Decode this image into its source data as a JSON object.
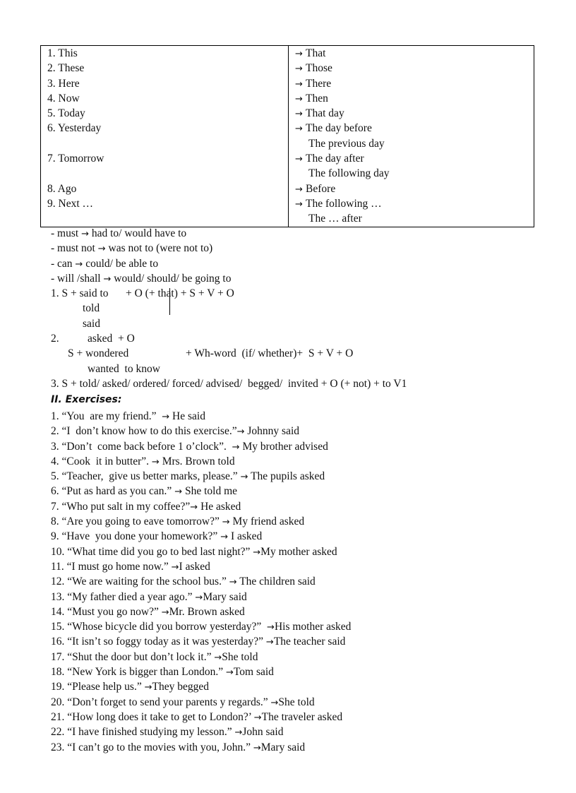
{
  "table": {
    "rows": [
      {
        "left": [
          "1. This"
        ],
        "right": [
          "That"
        ]
      },
      {
        "left": [
          "2. These"
        ],
        "right": [
          "Those"
        ]
      },
      {
        "left": [
          "3. Here"
        ],
        "right": [
          "There"
        ]
      },
      {
        "left": [
          "4. Now"
        ],
        "right": [
          "Then"
        ]
      },
      {
        "left": [
          "5. Today"
        ],
        "right": [
          "That day"
        ]
      },
      {
        "left": [
          "6. Yesterday"
        ],
        "right": [
          "The day before",
          "The previous day"
        ]
      },
      {
        "left": [
          "7. Tomorrow"
        ],
        "right": [
          "The day after",
          "The following day"
        ]
      },
      {
        "left": [
          "8. Ago"
        ],
        "right": [
          "Before"
        ]
      },
      {
        "left": [
          "9. Next …"
        ],
        "right": [
          "The following …",
          "The … after"
        ]
      }
    ],
    "arrow": "→"
  },
  "modals": [
    {
      "from": "- must",
      "to": "had to/ would have to"
    },
    {
      "from": "- must not",
      "to": "was not to (were not to)"
    },
    {
      "from": "- can",
      "to": "could/ be able to"
    },
    {
      "from": "- will /shall",
      "to": "would/ should/ be going to"
    }
  ],
  "formulas": {
    "f1_a": "1. S + said to",
    "f1_b": "+ O (+ that) + S + V + O",
    "f1_told": "told",
    "f1_said": "said",
    "f2_num": "2.",
    "f2_asked": "asked  + O",
    "f2_s": "S + wondered",
    "f2_wh": "+ Wh-word  (if/ whether)+  S + V + O",
    "f2_wanted": "wanted  to know",
    "f3": "3. S + told/ asked/ ordered/ forced/ advised/  begged/  invited + O (+ not) + to V1"
  },
  "exercises_title": "II. Exercises:",
  "exercises": [
    {
      "q": "1. “You  are my friend.”  ",
      "a": " He said"
    },
    {
      "q": "2. “I  don’t know how to do this exercise.”",
      "a": " Johnny said"
    },
    {
      "q": "3. “Don’t  come back before 1 o’clock”.  ",
      "a": " My brother advised"
    },
    {
      "q": "4. “Cook  it in butter”. ",
      "a": " Mrs. Brown told"
    },
    {
      "q": "5. “Teacher,  give us better marks, please.” ",
      "a": " The pupils asked"
    },
    {
      "q": "6. “Put as hard as you can.” ",
      "a": " She told me"
    },
    {
      "q": "7. “Who put salt in my coffee?”",
      "a": " He asked"
    },
    {
      "q": "8. “Are you going to eave tomorrow?” ",
      "a": " My friend asked"
    },
    {
      "q": "9. “Have  you done your homework?” ",
      "a": " I asked"
    },
    {
      "q": "10. “What time did you go to bed last night?” ",
      "a": "My mother asked"
    },
    {
      "q": "11. “I must go home now.” ",
      "a": "I asked"
    },
    {
      "q": "12. “We are waiting for the school bus.” ",
      "a": " The children said"
    },
    {
      "q": "13. “My father died a year ago.” ",
      "a": "Mary said"
    },
    {
      "q": "14. “Must you go now?” ",
      "a": "Mr. Brown asked"
    },
    {
      "q": "15. “Whose bicycle did you borrow yesterday?”  ",
      "a": "His mother asked"
    },
    {
      "q": "16. “It isn’t so foggy today as it was yesterday?” ",
      "a": "The teacher said"
    },
    {
      "q": "17. “Shut the door but don’t lock it.” ",
      "a": "She told"
    },
    {
      "q": "18. “New York is bigger than London.” ",
      "a": "Tom said"
    },
    {
      "q": "19. “Please help us.” ",
      "a": "They begged"
    },
    {
      "q": "20. “Don’t forget to send your parents y regards.” ",
      "a": "She told"
    },
    {
      "q": "21. “How long does it take to get to London?’ ",
      "a": "The traveler asked"
    },
    {
      "q": "22. “I have finished studying my lesson.” ",
      "a": "John said"
    },
    {
      "q": "23. “I can’t go to the movies with you, John.” ",
      "a": "Mary said"
    }
  ]
}
